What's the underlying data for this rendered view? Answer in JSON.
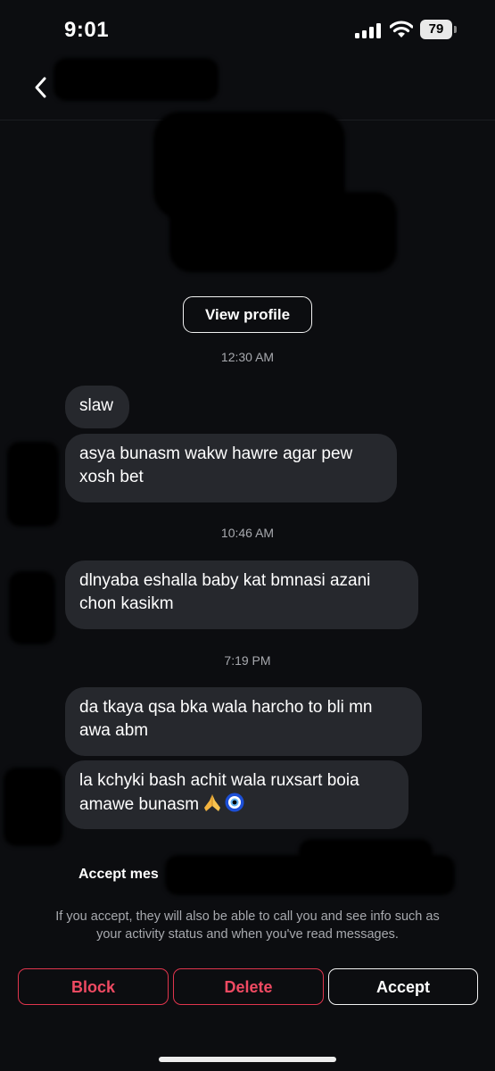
{
  "status_bar": {
    "time": "9:01",
    "battery": "79"
  },
  "header": {
    "back_icon": "chevron-left-icon"
  },
  "profile": {
    "view_profile_label": "View profile"
  },
  "messages": [
    {
      "timestamp": "12:30 AM"
    },
    {
      "lines": [
        "slaw"
      ]
    },
    {
      "lines": [
        "asya bunasm wakw hawre agar pew",
        "xosh bet"
      ]
    },
    {
      "timestamp": "10:46 AM"
    },
    {
      "lines": [
        "dlnyaba eshalla baby kat bmnasi azani",
        "chon kasikm"
      ]
    },
    {
      "timestamp": "7:19 PM"
    },
    {
      "lines": [
        "da tkaya qsa bka wala harcho to bli mn",
        "awa abm"
      ]
    },
    {
      "lines": [
        "la kchyki bash achit wala ruxsart boia",
        "amawe bunasm"
      ],
      "emojis": [
        "folded-hands-emoji",
        "nazar-amulet-emoji"
      ]
    }
  ],
  "request": {
    "title": "Accept mes",
    "description_line1": "If you accept, they will also be able to call you and see info such as",
    "description_line2": "your activity status and when you've read messages."
  },
  "actions": {
    "block_label": "Block",
    "delete_label": "Delete",
    "accept_label": "Accept"
  },
  "colors": {
    "background": "#0c0d10",
    "bubble": "#26282d",
    "danger": "#ef4a62",
    "muted_text": "#a7a9ae"
  }
}
